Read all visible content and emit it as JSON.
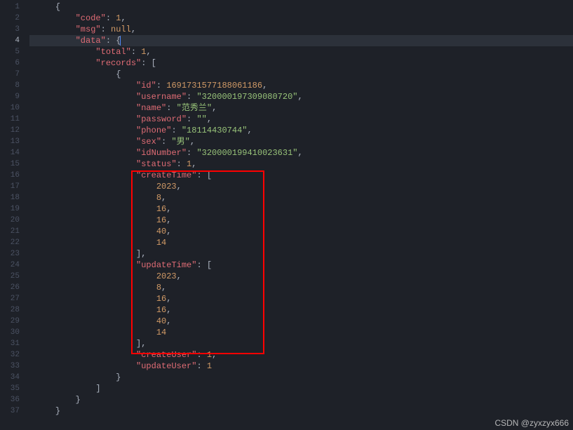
{
  "lines": [
    {
      "n": "1",
      "tokens": [
        {
          "c": "punc",
          "t": "{"
        }
      ],
      "indent": 1
    },
    {
      "n": "2",
      "tokens": [
        {
          "c": "key",
          "t": "\"code\""
        },
        {
          "c": "punc",
          "t": ": "
        },
        {
          "c": "num",
          "t": "1"
        },
        {
          "c": "punc",
          "t": ","
        }
      ],
      "indent": 2
    },
    {
      "n": "3",
      "tokens": [
        {
          "c": "key",
          "t": "\"msg\""
        },
        {
          "c": "punc",
          "t": ": "
        },
        {
          "c": "null",
          "t": "null"
        },
        {
          "c": "punc",
          "t": ","
        }
      ],
      "indent": 2
    },
    {
      "n": "4",
      "tokens": [
        {
          "c": "key",
          "t": "\"data\""
        },
        {
          "c": "punc",
          "t": ": {"
        }
      ],
      "indent": 2,
      "active": true,
      "cursor": true
    },
    {
      "n": "5",
      "tokens": [
        {
          "c": "key",
          "t": "\"total\""
        },
        {
          "c": "punc",
          "t": ": "
        },
        {
          "c": "num",
          "t": "1"
        },
        {
          "c": "punc",
          "t": ","
        }
      ],
      "indent": 3
    },
    {
      "n": "6",
      "tokens": [
        {
          "c": "key",
          "t": "\"records\""
        },
        {
          "c": "punc",
          "t": ": ["
        }
      ],
      "indent": 3
    },
    {
      "n": "7",
      "tokens": [
        {
          "c": "punc",
          "t": "{"
        }
      ],
      "indent": 4
    },
    {
      "n": "8",
      "tokens": [
        {
          "c": "key",
          "t": "\"id\""
        },
        {
          "c": "punc",
          "t": ": "
        },
        {
          "c": "num",
          "t": "1691731577188061186"
        },
        {
          "c": "punc",
          "t": ","
        }
      ],
      "indent": 5
    },
    {
      "n": "9",
      "tokens": [
        {
          "c": "key",
          "t": "\"username\""
        },
        {
          "c": "punc",
          "t": ": "
        },
        {
          "c": "str",
          "t": "\"320000197309080720\""
        },
        {
          "c": "punc",
          "t": ","
        }
      ],
      "indent": 5
    },
    {
      "n": "10",
      "tokens": [
        {
          "c": "key",
          "t": "\"name\""
        },
        {
          "c": "punc",
          "t": ": "
        },
        {
          "c": "str",
          "t": "\"范秀兰\""
        },
        {
          "c": "punc",
          "t": ","
        }
      ],
      "indent": 5
    },
    {
      "n": "11",
      "tokens": [
        {
          "c": "key",
          "t": "\"password\""
        },
        {
          "c": "punc",
          "t": ": "
        },
        {
          "c": "str",
          "t": "\"\""
        },
        {
          "c": "punc",
          "t": ","
        }
      ],
      "indent": 5
    },
    {
      "n": "12",
      "tokens": [
        {
          "c": "key",
          "t": "\"phone\""
        },
        {
          "c": "punc",
          "t": ": "
        },
        {
          "c": "str",
          "t": "\"18114430744\""
        },
        {
          "c": "punc",
          "t": ","
        }
      ],
      "indent": 5
    },
    {
      "n": "13",
      "tokens": [
        {
          "c": "key",
          "t": "\"sex\""
        },
        {
          "c": "punc",
          "t": ": "
        },
        {
          "c": "str",
          "t": "\"男\""
        },
        {
          "c": "punc",
          "t": ","
        }
      ],
      "indent": 5
    },
    {
      "n": "14",
      "tokens": [
        {
          "c": "key",
          "t": "\"idNumber\""
        },
        {
          "c": "punc",
          "t": ": "
        },
        {
          "c": "str",
          "t": "\"320000199410023631\""
        },
        {
          "c": "punc",
          "t": ","
        }
      ],
      "indent": 5
    },
    {
      "n": "15",
      "tokens": [
        {
          "c": "key",
          "t": "\"status\""
        },
        {
          "c": "punc",
          "t": ": "
        },
        {
          "c": "num",
          "t": "1"
        },
        {
          "c": "punc",
          "t": ","
        }
      ],
      "indent": 5
    },
    {
      "n": "16",
      "tokens": [
        {
          "c": "key",
          "t": "\"createTime\""
        },
        {
          "c": "punc",
          "t": ": ["
        }
      ],
      "indent": 5
    },
    {
      "n": "17",
      "tokens": [
        {
          "c": "num",
          "t": "2023"
        },
        {
          "c": "punc",
          "t": ","
        }
      ],
      "indent": 6
    },
    {
      "n": "18",
      "tokens": [
        {
          "c": "num",
          "t": "8"
        },
        {
          "c": "punc",
          "t": ","
        }
      ],
      "indent": 6
    },
    {
      "n": "19",
      "tokens": [
        {
          "c": "num",
          "t": "16"
        },
        {
          "c": "punc",
          "t": ","
        }
      ],
      "indent": 6
    },
    {
      "n": "20",
      "tokens": [
        {
          "c": "num",
          "t": "16"
        },
        {
          "c": "punc",
          "t": ","
        }
      ],
      "indent": 6
    },
    {
      "n": "21",
      "tokens": [
        {
          "c": "num",
          "t": "40"
        },
        {
          "c": "punc",
          "t": ","
        }
      ],
      "indent": 6
    },
    {
      "n": "22",
      "tokens": [
        {
          "c": "num",
          "t": "14"
        }
      ],
      "indent": 6
    },
    {
      "n": "23",
      "tokens": [
        {
          "c": "punc",
          "t": "],"
        }
      ],
      "indent": 5
    },
    {
      "n": "24",
      "tokens": [
        {
          "c": "key",
          "t": "\"updateTime\""
        },
        {
          "c": "punc",
          "t": ": ["
        }
      ],
      "indent": 5
    },
    {
      "n": "25",
      "tokens": [
        {
          "c": "num",
          "t": "2023"
        },
        {
          "c": "punc",
          "t": ","
        }
      ],
      "indent": 6
    },
    {
      "n": "26",
      "tokens": [
        {
          "c": "num",
          "t": "8"
        },
        {
          "c": "punc",
          "t": ","
        }
      ],
      "indent": 6
    },
    {
      "n": "27",
      "tokens": [
        {
          "c": "num",
          "t": "16"
        },
        {
          "c": "punc",
          "t": ","
        }
      ],
      "indent": 6
    },
    {
      "n": "28",
      "tokens": [
        {
          "c": "num",
          "t": "16"
        },
        {
          "c": "punc",
          "t": ","
        }
      ],
      "indent": 6
    },
    {
      "n": "29",
      "tokens": [
        {
          "c": "num",
          "t": "40"
        },
        {
          "c": "punc",
          "t": ","
        }
      ],
      "indent": 6
    },
    {
      "n": "30",
      "tokens": [
        {
          "c": "num",
          "t": "14"
        }
      ],
      "indent": 6
    },
    {
      "n": "31",
      "tokens": [
        {
          "c": "punc",
          "t": "],"
        }
      ],
      "indent": 5
    },
    {
      "n": "32",
      "tokens": [
        {
          "c": "key",
          "t": "\"createUser\""
        },
        {
          "c": "punc",
          "t": ": "
        },
        {
          "c": "num",
          "t": "1"
        },
        {
          "c": "punc",
          "t": ","
        }
      ],
      "indent": 5
    },
    {
      "n": "33",
      "tokens": [
        {
          "c": "key",
          "t": "\"updateUser\""
        },
        {
          "c": "punc",
          "t": ": "
        },
        {
          "c": "num",
          "t": "1"
        }
      ],
      "indent": 5
    },
    {
      "n": "34",
      "tokens": [
        {
          "c": "punc",
          "t": "}"
        }
      ],
      "indent": 4
    },
    {
      "n": "35",
      "tokens": [
        {
          "c": "punc",
          "t": "]"
        }
      ],
      "indent": 3
    },
    {
      "n": "36",
      "tokens": [
        {
          "c": "punc",
          "t": "}"
        }
      ],
      "indent": 2
    },
    {
      "n": "37",
      "tokens": [
        {
          "c": "punc",
          "t": "}"
        }
      ],
      "indent": 1
    }
  ],
  "watermark": "CSDN @zyxzyx666"
}
